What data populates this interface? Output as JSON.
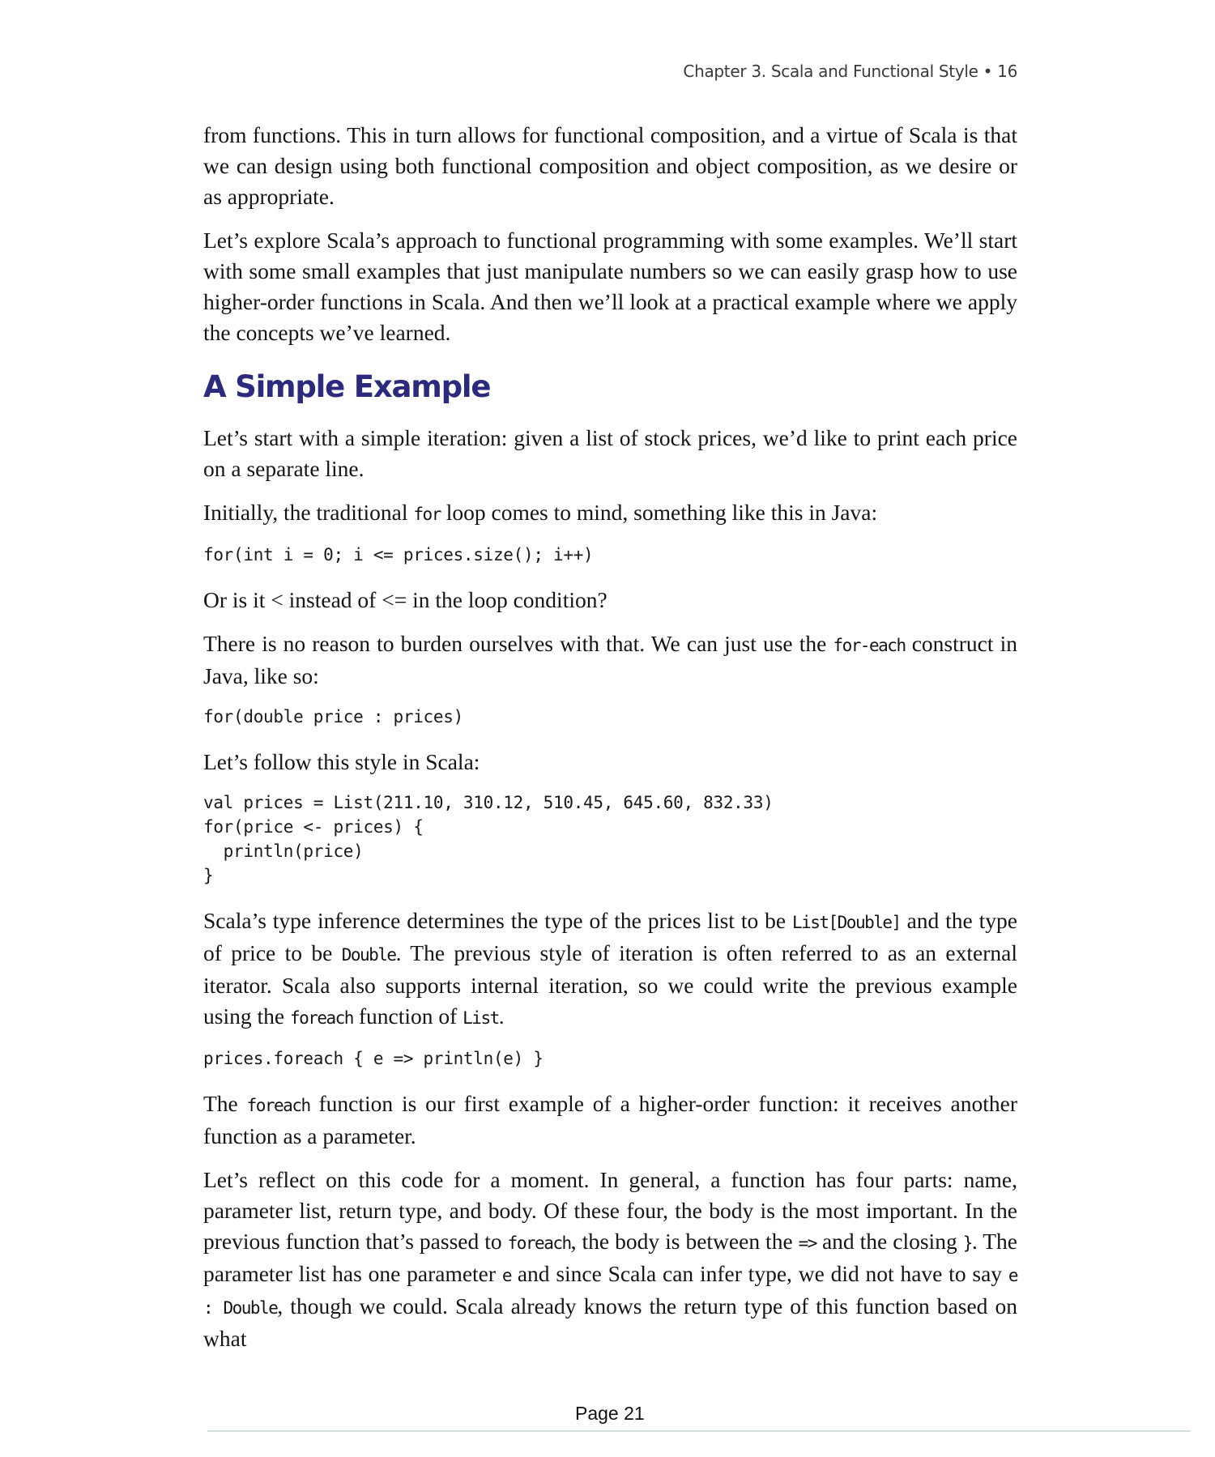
{
  "header": {
    "chapter": "Chapter 3. Scala and Functional Style",
    "bullet": "•",
    "page_number": "16"
  },
  "section_title": "A Simple Example",
  "paragraphs": {
    "p1": "from functions. This in turn allows for functional composition, and a virtue of Scala is that we can design using both functional composition and object composition, as we desire or as appropriate.",
    "p2": "Let’s explore Scala’s approach to functional programming with some examples. We’ll start with some small examples that just manipulate numbers so we can easily grasp how to use higher-order functions in Scala. And then we’ll look at a practical example where we apply the concepts we’ve learned.",
    "p3": "Let’s start with a simple iteration: given a list of stock prices, we’d like to print each price on a separate line.",
    "p4": {
      "a": "Initially, the traditional ",
      "code": "for",
      "b": " loop comes to mind, something like this in Java:"
    },
    "p5": "Or is it < instead of <= in the loop condition?",
    "p6": {
      "a": "There is no reason to burden ourselves with that. We can just use the ",
      "code": "for-each",
      "b": " construct in Java, like so:"
    },
    "p7": "Let’s follow this style in Scala:",
    "p8": {
      "a": "Scala’s type inference determines the type of the prices list to be ",
      "code1": "List[Double]",
      "b": " and the type of price to be ",
      "code2": "Double",
      "c": ". The previous style of iteration is often referred to as an external iterator. Scala also supports internal iteration, so we could write the previous example using the ",
      "code3": "foreach",
      "d": " function of ",
      "code4": "List",
      "e": "."
    },
    "p9": {
      "a": "The ",
      "code": "foreach",
      "b": " function is our first example of a higher-order function: it receives another function as a parameter."
    },
    "p10": {
      "a": "Let’s reflect on this code for a moment. In general, a function has four parts: name, parameter list, return type, and body. Of these four, the body is the most important. In the previous function that’s passed to ",
      "code1": "foreach",
      "b": ", the body is between the ",
      "code2": "=>",
      "c": " and the closing ",
      "code3": "}",
      "d": ". The parameter list has one parameter ",
      "code4": "e",
      "e": " and since Scala can infer type, we did not have to say ",
      "code5": "e : Double",
      "f": ", though we could. Scala already knows the return type of this function based on what"
    }
  },
  "code_blocks": {
    "java_for": "for(int i = 0; i <= prices.size(); i++)",
    "java_foreach": "for(double price : prices)",
    "scala_for": "val prices = List(211.10, 310.12, 510.45, 645.60, 832.33)\nfor(price <- prices) {\n  println(price)\n}",
    "scala_foreach": "prices.foreach { e => println(e) }"
  },
  "footer": {
    "page_label": "Page 21"
  },
  "colors": {
    "heading": "#2b2a7d",
    "text": "#151515",
    "footer_rule": "#d7dede"
  }
}
